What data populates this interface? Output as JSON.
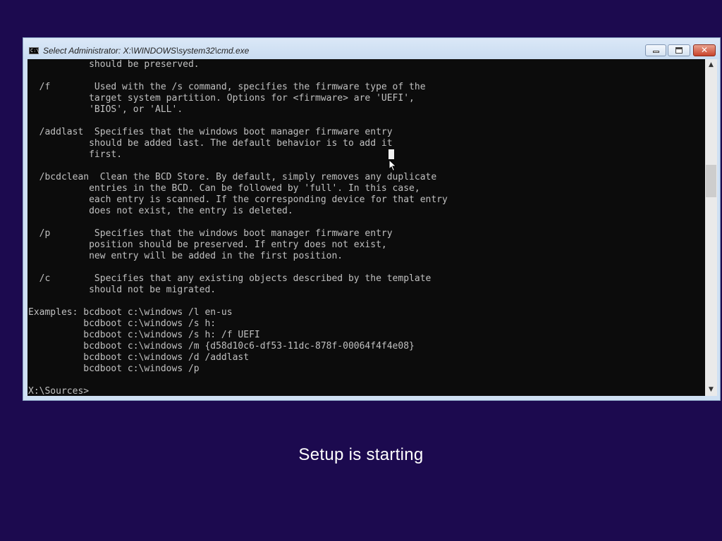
{
  "window": {
    "title": "Select Administrator: X:\\WINDOWS\\system32\\cmd.exe",
    "icon": "console-app-icon",
    "icon_label": "C:\\",
    "buttons": {
      "minimize": "minimize-icon",
      "maximize": "maximize-icon",
      "close": "close-icon",
      "close_label": "✕"
    }
  },
  "console": {
    "lines": [
      "           should be preserved.",
      "",
      "  /f        Used with the /s command, specifies the firmware type of the",
      "           target system partition. Options for <firmware> are 'UEFI',",
      "           'BIOS', or 'ALL'.",
      "",
      "  /addlast  Specifies that the windows boot manager firmware entry",
      "           should be added last. The default behavior is to add it",
      "           first.",
      "",
      "  /bcdclean  Clean the BCD Store. By default, simply removes any duplicate",
      "           entries in the BCD. Can be followed by 'full'. In this case,",
      "           each entry is scanned. If the corresponding device for that entry",
      "           does not exist, the entry is deleted.",
      "",
      "  /p        Specifies that the windows boot manager firmware entry",
      "           position should be preserved. If entry does not exist,",
      "           new entry will be added in the first position.",
      "",
      "  /c        Specifies that any existing objects described by the template",
      "           should not be migrated.",
      "",
      "Examples: bcdboot c:\\windows /l en-us",
      "          bcdboot c:\\windows /s h:",
      "          bcdboot c:\\windows /s h: /f UEFI",
      "          bcdboot c:\\windows /m {d58d10c6-df53-11dc-878f-00064f4f4e08}",
      "          bcdboot c:\\windows /d /addlast",
      "          bcdboot c:\\windows /p",
      "",
      "X:\\Sources>"
    ],
    "text_color": "#c0c0c0",
    "background_color": "#0c0c0c"
  },
  "scrollbar": {
    "up_arrow": "▲",
    "down_arrow": "▼"
  },
  "status": {
    "setup_message": "Setup is starting"
  },
  "colors": {
    "desktop_background": "#1c0a4f",
    "window_frame": "#cfe0f3",
    "close_button": "#c8432b"
  }
}
